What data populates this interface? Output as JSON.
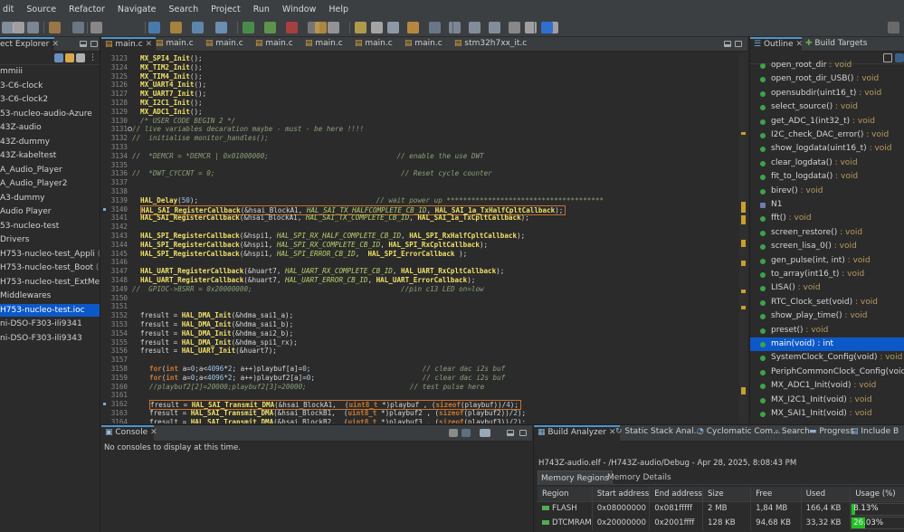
{
  "menu": [
    "dit",
    "Source",
    "Refactor",
    "Navigate",
    "Search",
    "Project",
    "Run",
    "Window",
    "Help"
  ],
  "explorer": {
    "title": "ect Explorer",
    "items": [
      {
        "label": "mmiii"
      },
      {
        "label": "3-C6-clock"
      },
      {
        "label": "3-C6-clock2"
      },
      {
        "label": "53-nucleo-audio-Azure"
      },
      {
        "label": "43Z-audio"
      },
      {
        "label": "43Z-dummy"
      },
      {
        "label": "43Z-kabeltest"
      },
      {
        "label": "A_Audio_Player"
      },
      {
        "label": "A_Audio_Player2"
      },
      {
        "label": "A3-dummy"
      },
      {
        "label": "Audio Player"
      },
      {
        "label": "53-nucleo-test"
      },
      {
        "label": "Drivers"
      },
      {
        "label": "H753-nucleo-test_Appli",
        "extra": " (in Ap"
      },
      {
        "label": "H753-nucleo-test_Boot",
        "extra": " (in Bo"
      },
      {
        "label": "H753-nucleo-test_ExtMemLoa"
      },
      {
        "label": "Middlewares"
      },
      {
        "label": "H753-nucleo-test.ioc",
        "selected": true
      },
      {
        "label": "ni-DSO-F303-ili9341"
      },
      {
        "label": "ni-DSO-F303-ili9343"
      }
    ]
  },
  "editor_tabs": [
    {
      "label": "main.c",
      "active": true
    },
    {
      "label": "main.c"
    },
    {
      "label": "main.c"
    },
    {
      "label": "main.c"
    },
    {
      "label": "main.c"
    },
    {
      "label": "main.c"
    },
    {
      "label": "main.c"
    },
    {
      "label": "stm32h7xx_it.c"
    }
  ],
  "code_lines": [
    {
      "n": "3123",
      "segs": [
        [
          "MX_SPI4_Init",
          "fn"
        ],
        [
          "();",
          ""
        ]
      ]
    },
    {
      "n": "3124",
      "segs": [
        [
          "MX_TIM2_Init",
          "fn"
        ],
        [
          "();",
          ""
        ]
      ]
    },
    {
      "n": "3125",
      "segs": [
        [
          "MX_TIM4_Init",
          "fn"
        ],
        [
          "();",
          ""
        ]
      ]
    },
    {
      "n": "3126",
      "segs": [
        [
          "MX_UART4_Init",
          "fn"
        ],
        [
          "();",
          ""
        ]
      ]
    },
    {
      "n": "3127",
      "segs": [
        [
          "MX_UART7_Init",
          "fn"
        ],
        [
          "();",
          ""
        ]
      ]
    },
    {
      "n": "3128",
      "segs": [
        [
          "MX_I2C1_Init",
          "fn"
        ],
        [
          "();",
          ""
        ]
      ]
    },
    {
      "n": "3129",
      "segs": [
        [
          "MX_ADC1_Init",
          "fn"
        ],
        [
          "();",
          ""
        ]
      ]
    },
    {
      "n": "3130",
      "segs": [
        [
          "/* USER CODE BEGIN 2 */",
          "cm"
        ]
      ]
    },
    {
      "n": "3131",
      "fold": true,
      "indent": -1,
      "segs": [
        [
          "// live variables decaration maybe - must - be here !!!!",
          "cm"
        ]
      ]
    },
    {
      "n": "3132",
      "indent": -1,
      "segs": [
        [
          "//  initialise monitor_handles();",
          "cm"
        ]
      ]
    },
    {
      "n": "3133",
      "segs": []
    },
    {
      "n": "3134",
      "indent": -1,
      "segs": [
        [
          "//  *DEMCR = *DEMCR | 0x01000000;                               // enable the use DWT",
          "cm"
        ]
      ]
    },
    {
      "n": "3135",
      "segs": []
    },
    {
      "n": "3136",
      "indent": -1,
      "segs": [
        [
          "//  *DWT_CYCCNT = 0;                                             // Reset cycle counter",
          "cm"
        ]
      ]
    },
    {
      "n": "3137",
      "segs": []
    },
    {
      "n": "3138",
      "segs": []
    },
    {
      "n": "3139",
      "segs": [
        [
          "HAL_Delay",
          "fn"
        ],
        [
          "(",
          ""
        ],
        [
          "50",
          "num"
        ],
        [
          ");                                           ",
          ""
        ],
        [
          "// wait power up **************************************",
          "cm"
        ]
      ]
    },
    {
      "n": "3140",
      "hl": true,
      "segs": [
        [
          "HAL_SAI_RegisterCallback",
          "fn"
        ],
        [
          "(&hsai_BlockA1, ",
          ""
        ],
        [
          "HAL_SAI_TX_HALFCOMPLETE_CB_ID",
          "it"
        ],
        [
          ", ",
          ""
        ],
        [
          "HAL_SAI_1a_TxHalfCpltCallback",
          "fn"
        ],
        [
          ");",
          ""
        ]
      ]
    },
    {
      "n": "3141",
      "segs": [
        [
          "HAL_SAI_RegisterCallback",
          "fn"
        ],
        [
          "(&hsai_BlockA1, ",
          ""
        ],
        [
          "HAL_SAI_TX_COMPLETE_CB_ID",
          "it"
        ],
        [
          ", ",
          ""
        ],
        [
          "HAL_SAI_1a_TxCpltCallback",
          "fn"
        ],
        [
          ");",
          ""
        ]
      ]
    },
    {
      "n": "3142",
      "segs": []
    },
    {
      "n": "3143",
      "segs": [
        [
          "HAL_SPI_RegisterCallback",
          "fn"
        ],
        [
          "(&hspi1, ",
          ""
        ],
        [
          "HAL_SPI_RX_HALF_COMPLETE_CB_ID",
          "it"
        ],
        [
          ", ",
          ""
        ],
        [
          "HAL_SPI_RxHalfCpltCallback",
          "fn"
        ],
        [
          ");",
          ""
        ]
      ]
    },
    {
      "n": "3144",
      "segs": [
        [
          "HAL_SPI_RegisterCallback",
          "fn"
        ],
        [
          "(&hspi1, ",
          ""
        ],
        [
          "HAL_SPI_RX_COMPLETE_CB_ID",
          "it"
        ],
        [
          ", ",
          ""
        ],
        [
          "HAL_SPI_RxCpltCallback",
          "fn"
        ],
        [
          ");",
          ""
        ]
      ]
    },
    {
      "n": "3145",
      "segs": [
        [
          "HAL_SPI_RegisterCallback",
          "fn"
        ],
        [
          "(&hspi1, ",
          ""
        ],
        [
          "HAL_SPI_ERROR_CB_ID",
          "it"
        ],
        [
          ",  ",
          ""
        ],
        [
          "HAL_SPI_ErrorCallback",
          "fn"
        ],
        [
          " );",
          ""
        ]
      ]
    },
    {
      "n": "3146",
      "segs": []
    },
    {
      "n": "3147",
      "segs": [
        [
          "HAL_UART_RegisterCallback",
          "fn"
        ],
        [
          "(&huart7, ",
          ""
        ],
        [
          "HAL_UART_RX_COMPLETE_CB_ID",
          "it"
        ],
        [
          ", ",
          ""
        ],
        [
          "HAL_UART_RxCpltCallback",
          "fn"
        ],
        [
          ");",
          ""
        ]
      ]
    },
    {
      "n": "3148",
      "segs": [
        [
          "HAL_UART_RegisterCallback",
          "fn"
        ],
        [
          "(&huart7, ",
          ""
        ],
        [
          "HAL_UART_ERROR_CB_ID",
          "it"
        ],
        [
          ", ",
          ""
        ],
        [
          "HAL_UART_ErrorCallback",
          "fn"
        ],
        [
          ");",
          ""
        ]
      ]
    },
    {
      "n": "3149",
      "indent": -1,
      "segs": [
        [
          "//  GPIOC->BSRR = 0x20000000;                                    //pin c13 LED on=low",
          "cm"
        ]
      ]
    },
    {
      "n": "3150",
      "segs": []
    },
    {
      "n": "3151",
      "segs": []
    },
    {
      "n": "3152",
      "segs": [
        [
          "fresult = ",
          ""
        ],
        [
          "HAL_DMA_Init",
          "fn"
        ],
        [
          "(&hdma_sai1_a);",
          ""
        ]
      ]
    },
    {
      "n": "3153",
      "segs": [
        [
          "fresult = ",
          ""
        ],
        [
          "HAL_DMA_Init",
          "fn"
        ],
        [
          "(&hdma_sai1_b);",
          ""
        ]
      ]
    },
    {
      "n": "3154",
      "segs": [
        [
          "fresult = ",
          ""
        ],
        [
          "HAL_DMA_Init",
          "fn"
        ],
        [
          "(&hdma_sai2_b);",
          ""
        ]
      ]
    },
    {
      "n": "3155",
      "segs": [
        [
          "fresult = ",
          ""
        ],
        [
          "HAL_DMA_Init",
          "fn"
        ],
        [
          "(&hdma_spi1_rx);",
          ""
        ]
      ]
    },
    {
      "n": "3156",
      "segs": [
        [
          "fresult = ",
          ""
        ],
        [
          "HAL_UART_Init",
          "fn"
        ],
        [
          "(&huart7);",
          ""
        ]
      ]
    },
    {
      "n": "3157",
      "segs": []
    },
    {
      "n": "3158",
      "indent": 1,
      "segs": [
        [
          "for",
          "kw"
        ],
        [
          "(",
          ""
        ],
        [
          "int",
          "kw"
        ],
        [
          " a=",
          ""
        ],
        [
          "0",
          "num"
        ],
        [
          ";a<",
          ""
        ],
        [
          "4096",
          "num"
        ],
        [
          "*",
          ""
        ],
        [
          "2",
          "num"
        ],
        [
          "; a++)playbuf[a]=",
          ""
        ],
        [
          "0",
          "num"
        ],
        [
          ";                           ",
          ""
        ],
        [
          "// clear dac i2s buf",
          "cm"
        ]
      ]
    },
    {
      "n": "3159",
      "indent": 1,
      "segs": [
        [
          "for",
          "kw"
        ],
        [
          "(",
          ""
        ],
        [
          "int",
          "kw"
        ],
        [
          " a=",
          ""
        ],
        [
          "0",
          "num"
        ],
        [
          ";a<",
          ""
        ],
        [
          "4096",
          "num"
        ],
        [
          "*",
          ""
        ],
        [
          "2",
          "num"
        ],
        [
          "; a++)playbuf2[a]=",
          ""
        ],
        [
          "0",
          "num"
        ],
        [
          ";                          ",
          ""
        ],
        [
          "// clear dac i2s buf",
          "cm"
        ]
      ]
    },
    {
      "n": "3160",
      "indent": 1,
      "segs": [
        [
          "//playbuf2[2]=20000;playbuf2[3]=20000;",
          "cm"
        ],
        [
          "                         ",
          ""
        ],
        [
          "// test pulse here",
          "cm"
        ]
      ]
    },
    {
      "n": "3161",
      "segs": []
    },
    {
      "n": "3162",
      "hl": true,
      "mark": true,
      "indent": 1,
      "segs": [
        [
          "fresult = ",
          ""
        ],
        [
          "HAL_SAI_Transmit_DMA",
          "fn"
        ],
        [
          "(&hsai_BlockA1,  (",
          ""
        ],
        [
          "uint8_t",
          "kw"
        ],
        [
          " *)playbuf , (",
          ""
        ],
        [
          "sizeof",
          "kw"
        ],
        [
          "(playbuf))/",
          ""
        ],
        [
          "4",
          "num"
        ],
        [
          ");",
          ""
        ]
      ]
    },
    {
      "n": "3163",
      "indent": 1,
      "segs": [
        [
          "fresult = ",
          ""
        ],
        [
          "HAL_SAI_Transmit_DMA",
          "fn"
        ],
        [
          "(&hsai_BlockB1,  (",
          ""
        ],
        [
          "uint8_t",
          "kw"
        ],
        [
          " *)playbuf2 , (",
          ""
        ],
        [
          "sizeof",
          "kw"
        ],
        [
          "(playbuf2))/",
          ""
        ],
        [
          "2",
          "num"
        ],
        [
          ");",
          ""
        ]
      ]
    },
    {
      "n": "3164",
      "indent": 1,
      "segs": [
        [
          "fresult = ",
          ""
        ],
        [
          "HAL_SAI_Transmit_DMA",
          "fn"
        ],
        [
          "(&hsai_BlockB2,  (",
          ""
        ],
        [
          "uint8_t",
          "kw"
        ],
        [
          " *)playbuf3 , (",
          ""
        ],
        [
          "sizeof",
          "kw"
        ],
        [
          "(playbuf3))/",
          ""
        ],
        [
          "2",
          "num"
        ],
        [
          ");",
          ""
        ]
      ]
    }
  ],
  "outline": {
    "tabs": [
      {
        "label": "Outline",
        "active": true
      },
      {
        "label": "Build Targets"
      }
    ],
    "items": [
      {
        "name": "open_root_dir",
        "type": "void"
      },
      {
        "name": "open_root_dir_USB()",
        "type": "void"
      },
      {
        "name": "opensubdir(uint16_t)",
        "type": "void"
      },
      {
        "name": "select_source()",
        "type": "void"
      },
      {
        "name": "get_ADC_1(int32_t)",
        "type": "void"
      },
      {
        "name": "I2C_check_DAC_error()",
        "type": "void"
      },
      {
        "name": "show_logdata(uint16_t)",
        "type": "void"
      },
      {
        "name": "clear_logdata()",
        "type": "void"
      },
      {
        "name": "fit_to_logdata()",
        "type": "void"
      },
      {
        "name": "birev()",
        "type": "void"
      },
      {
        "name": "N1",
        "type": ""
      },
      {
        "name": "fft()",
        "type": "void"
      },
      {
        "name": "screen_restore()",
        "type": "void"
      },
      {
        "name": "screen_lisa_0()",
        "type": "void"
      },
      {
        "name": "gen_pulse(int, int)",
        "type": "void"
      },
      {
        "name": "to_array(int16_t)",
        "type": "void"
      },
      {
        "name": "LISA()",
        "type": "void"
      },
      {
        "name": "RTC_Clock_set(void)",
        "type": "void"
      },
      {
        "name": "show_play_time()",
        "type": "void"
      },
      {
        "name": "preset()",
        "type": "void"
      },
      {
        "name": "main(void)",
        "type": "int",
        "selected": true
      },
      {
        "name": "SystemClock_Config(void)",
        "type": "void"
      },
      {
        "name": "PeriphCommonClock_Config(void)",
        "type": "v"
      },
      {
        "name": "MX_ADC1_Init(void)",
        "type": "void"
      },
      {
        "name": "MX_I2C1_Init(void)",
        "type": "void"
      },
      {
        "name": "MX_SAI1_Init(void)",
        "type": "void"
      }
    ]
  },
  "console": {
    "tab": "Console",
    "message": "No consoles to display at this time."
  },
  "analyzer": {
    "tabs": [
      "Build Analyzer",
      "Static Stack Anal...",
      "Cyclomatic Com...",
      "Search",
      "Progress",
      "Include B"
    ],
    "path": "H743Z-audio.elf - /H743Z-audio/Debug - Apr 28, 2025, 8:08:43 PM",
    "subtabs": [
      "Memory Regions",
      "Memory Details"
    ],
    "headers": [
      "Region",
      "Start address",
      "End address",
      "Size",
      "Free",
      "Used",
      "Usage (%)"
    ],
    "rows": [
      {
        "region": "FLASH",
        "start": "0x08000000",
        "end": "0x081fffff",
        "size": "2 MB",
        "free": "1,84 MB",
        "used": "166,4 KB",
        "usage": "8.13%",
        "usage_frac": 0.0813
      },
      {
        "region": "DTCMRAM",
        "start": "0x20000000",
        "end": "0x2001ffff",
        "size": "128 KB",
        "free": "94,68 KB",
        "used": "33,32 KB",
        "usage": "26.03%",
        "usage_frac": 0.2603
      }
    ]
  }
}
